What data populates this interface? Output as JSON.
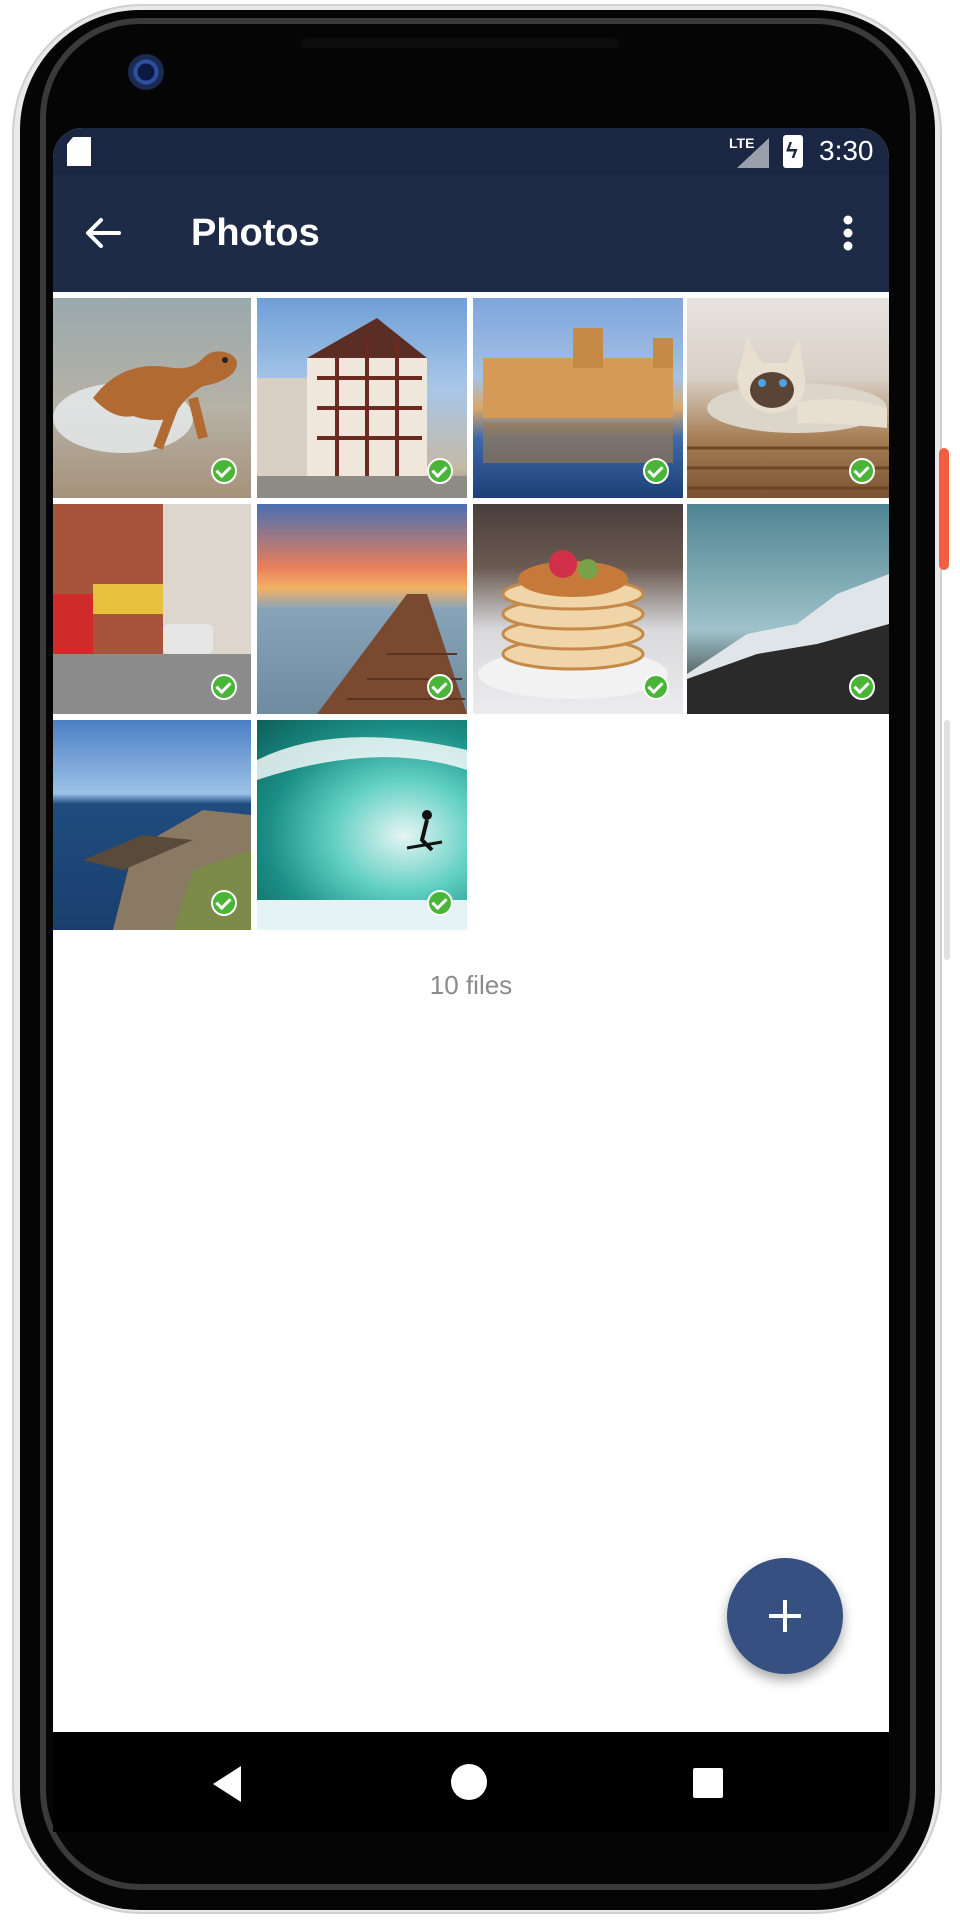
{
  "status_bar": {
    "network": "LTE",
    "time": "3:30"
  },
  "app_bar": {
    "title": "Photos"
  },
  "photos": [
    {
      "label": "dog",
      "selected": true
    },
    {
      "label": "half-timbered house",
      "selected": true
    },
    {
      "label": "palace reflection",
      "selected": true
    },
    {
      "label": "siamese cat",
      "selected": true
    },
    {
      "label": "city street",
      "selected": true
    },
    {
      "label": "pier at sunset",
      "selected": true
    },
    {
      "label": "pancakes",
      "selected": true
    },
    {
      "label": "snowy mountain",
      "selected": true
    },
    {
      "label": "rocky coast",
      "selected": true
    },
    {
      "label": "surfer wave",
      "selected": true
    }
  ],
  "footer": {
    "file_count": "10 files"
  },
  "colors": {
    "app_bar": "#1d2b47",
    "status_bar": "#1b2742",
    "fab": "#355081",
    "check": "#49b537"
  }
}
